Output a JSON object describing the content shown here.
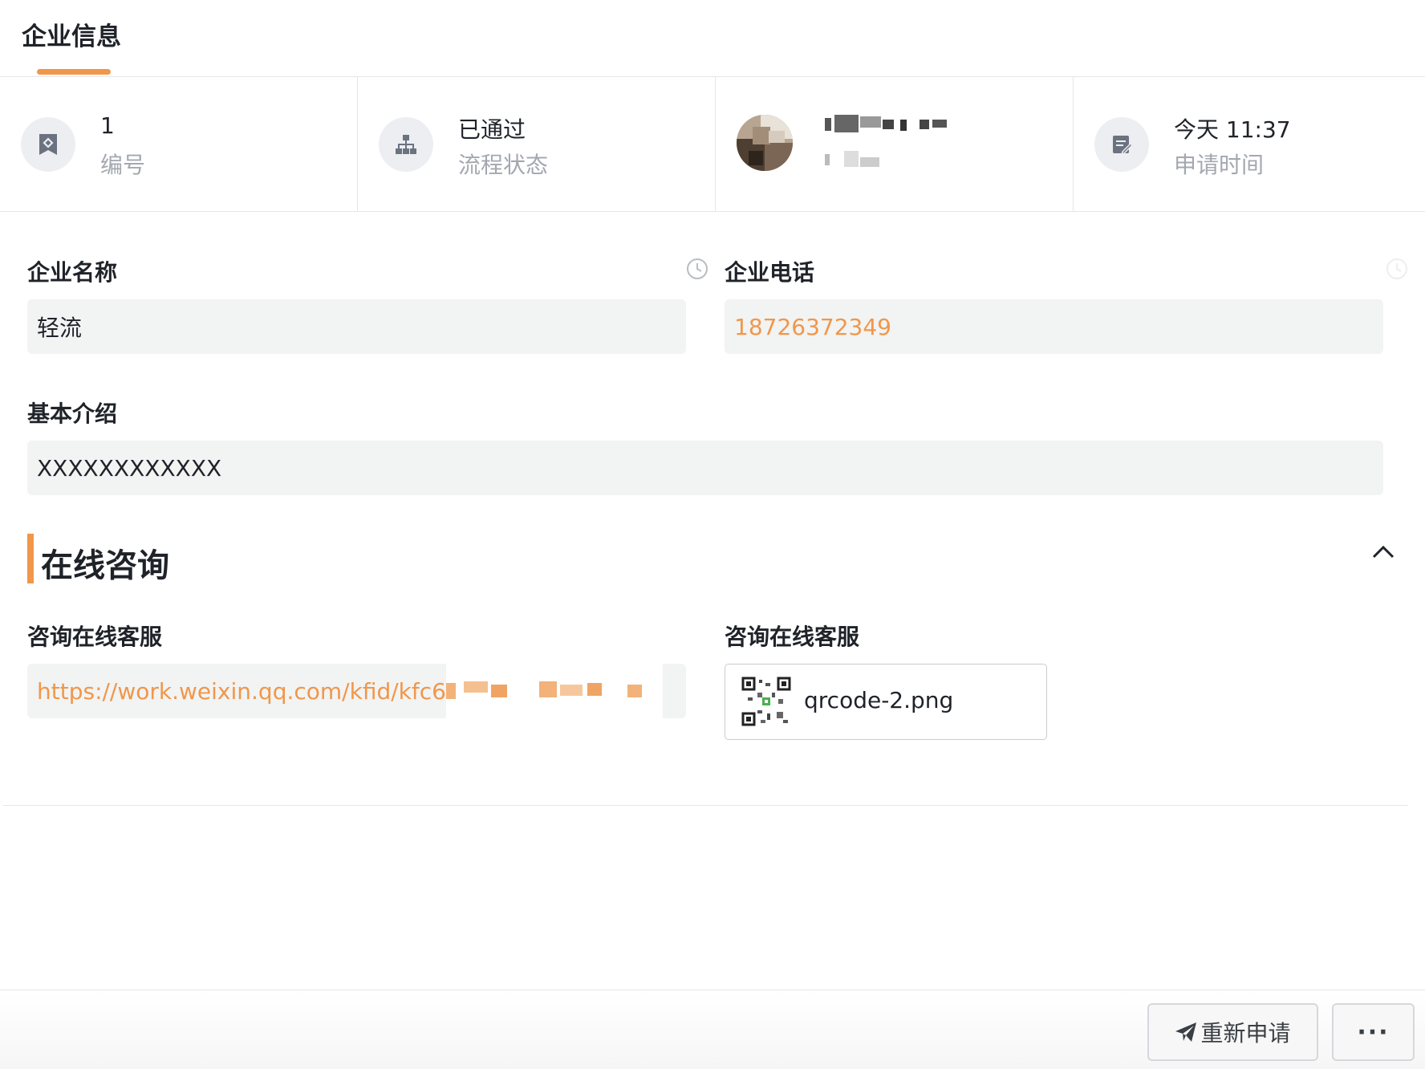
{
  "header": {
    "tab_label": "企业信息"
  },
  "info": {
    "number": {
      "value": "1",
      "label": "编号"
    },
    "status": {
      "value": "已通过",
      "label": "流程状态"
    },
    "applicant": {
      "name": "",
      "dept": ""
    },
    "time": {
      "value": "今天 11:37",
      "label": "申请时间"
    }
  },
  "form": {
    "company_name": {
      "label": "企业名称",
      "value": "轻流"
    },
    "company_phone": {
      "label": "企业电话",
      "value": "18726372349"
    },
    "intro": {
      "label": "基本介绍",
      "value": "XXXXXXXXXXXX"
    }
  },
  "section": {
    "title": "在线咨询",
    "link_field": {
      "label": "咨询在线客服",
      "value": "https://work.weixin.qq.com/kfid/kfc6"
    },
    "image_field": {
      "label": "咨询在线客服",
      "file_name": "qrcode-2.png"
    }
  },
  "footer": {
    "reapply_label": "重新申请",
    "more_label": "···"
  },
  "colors": {
    "accent": "#f0974a",
    "field_bg": "#f2f3f3",
    "muted_text": "#a3a8b0"
  },
  "icons": [
    "bookmark-icon",
    "org-chart-icon",
    "edit-note-icon",
    "history-icon",
    "chevron-up-icon",
    "send-icon",
    "qrcode-icon"
  ]
}
